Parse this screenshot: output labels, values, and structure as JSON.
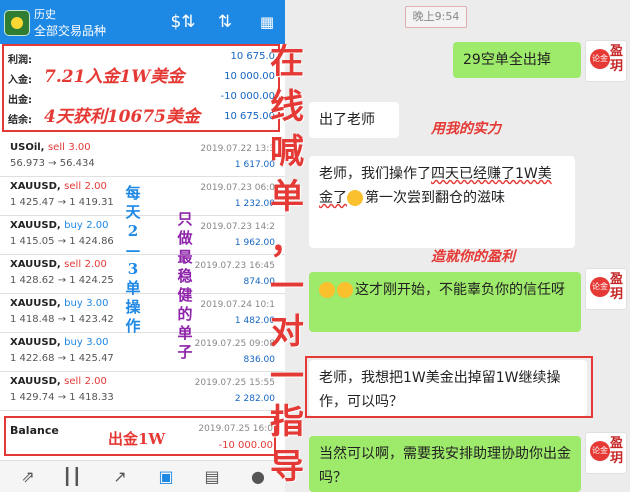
{
  "app": {
    "title": "历史",
    "subtitle": "全部交易品种",
    "icons": [
      "dollar-exchange-icon",
      "sort-icon",
      "calendar-icon"
    ]
  },
  "summary": {
    "rows": [
      {
        "label": "利润:",
        "value": "10 675.0"
      },
      {
        "label": "入金:",
        "value": "10 000.00"
      },
      {
        "label": "出金:",
        "value": "-10 000.00"
      },
      {
        "label": "结余:",
        "value": "10 675.00"
      }
    ]
  },
  "annotations": {
    "deposit": "7.21入金1W美金",
    "profit": "4天获利10675美金",
    "per_day": "每天2—3单操作",
    "stable": "只做最稳健的单子",
    "withdraw": "出金1W",
    "overlay": "在线喊单，一对一指导",
    "strength": "用我的实力",
    "achieve": "造就你的盈利"
  },
  "trades": [
    {
      "symbol": "USOil,",
      "side": "sell",
      "lots": "3.00",
      "price": "56.973 → 56.434",
      "date": "2019.07.22 13:3",
      "profit": "1 617.00"
    },
    {
      "symbol": "XAUUSD,",
      "side": "sell",
      "lots": "2.00",
      "price": "1 425.47 → 1 419.31",
      "date": "2019.07.23 06:0",
      "profit": "1 232.00"
    },
    {
      "symbol": "XAUUSD,",
      "side": "buy",
      "lots": "2.00",
      "price": "1 415.05 → 1 424.86",
      "date": "2019.07.23 14:2",
      "profit": "1 962.00"
    },
    {
      "symbol": "XAUUSD,",
      "side": "sell",
      "lots": "2.00",
      "price": "1 428.62 → 1 424.25",
      "date": "2019.07.23 16:45",
      "profit": "874.00"
    },
    {
      "symbol": "XAUUSD,",
      "side": "buy",
      "lots": "3.00",
      "price": "1 418.48 → 1 423.42",
      "date": "2019.07.24 10:1",
      "profit": "1 482.00"
    },
    {
      "symbol": "XAUUSD,",
      "side": "buy",
      "lots": "3.00",
      "price": "1 422.68 → 1 425.47",
      "date": "2019.07.25 09:08",
      "profit": "836.00"
    },
    {
      "symbol": "XAUUSD,",
      "side": "sell",
      "lots": "2.00",
      "price": "1 429.74 → 1 418.33",
      "date": "2019.07.25 15:55",
      "profit": "2 282.00"
    }
  ],
  "balance": {
    "label": "Balance",
    "date": "2019.07.25 16:0",
    "value": "-10 000.00"
  },
  "bottomnav": [
    "trade-icon",
    "chart-candles-icon",
    "trend-icon",
    "history-icon",
    "news-icon",
    "chat-icon"
  ],
  "chat": {
    "timestamp": "晚上9:54",
    "msg1": "29空单全出掉",
    "msg2": "出了老师",
    "msg3_a": "老师，我们操作了",
    "msg3_hl1": "四天已经赚了",
    "msg3_hl2": "1W美金了",
    "msg3_b": "第一次尝到翻仓的滋味",
    "msg4": "这才刚开始，不能辜负你的信任呀",
    "msg5": "老师，我想把1W美金出掉留1W继续操作，可以吗？",
    "msg6": "当然可以啊，需要我安排助理协助你出金吗？",
    "avatar_glyph": "盈玥",
    "avatar_seal": "论金"
  }
}
